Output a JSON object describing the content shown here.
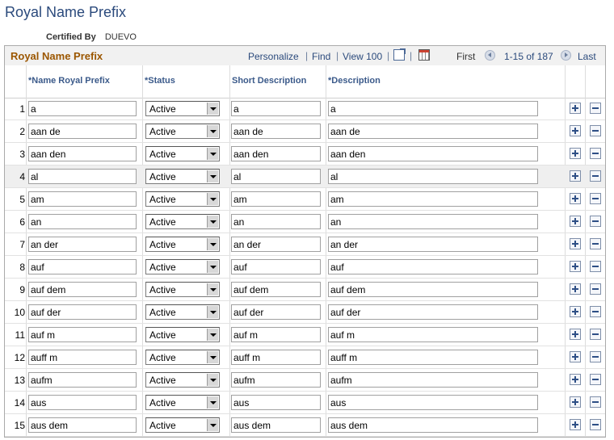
{
  "page": {
    "title": "Royal Name Prefix"
  },
  "certified": {
    "label": "Certified By",
    "value": "DUEVO"
  },
  "grid": {
    "title": "Royal Name Prefix",
    "personalize": "Personalize",
    "find": "Find",
    "view_all": "View 100",
    "first": "First",
    "range": "1-15 of 187",
    "last": "Last",
    "icons": {
      "popout": "new-window-icon",
      "download": "download-spreadsheet-icon",
      "prev": "previous-icon",
      "next": "next-icon",
      "add": "add-row-icon",
      "delete": "delete-row-icon"
    }
  },
  "columns": {
    "prefix": "*Name Royal Prefix",
    "status": "*Status",
    "short": "Short Description",
    "desc": "*Description"
  },
  "rows": [
    {
      "num": "1",
      "prefix": "a",
      "status": "Active",
      "short": "a",
      "desc": "a"
    },
    {
      "num": "2",
      "prefix": "aan de",
      "status": "Active",
      "short": "aan de",
      "desc": "aan de"
    },
    {
      "num": "3",
      "prefix": "aan den",
      "status": "Active",
      "short": "aan den",
      "desc": "aan den"
    },
    {
      "num": "4",
      "prefix": "al",
      "status": "Active",
      "short": "al",
      "desc": "al"
    },
    {
      "num": "5",
      "prefix": "am",
      "status": "Active",
      "short": "am",
      "desc": "am"
    },
    {
      "num": "6",
      "prefix": "an",
      "status": "Active",
      "short": "an",
      "desc": "an"
    },
    {
      "num": "7",
      "prefix": "an der",
      "status": "Active",
      "short": "an der",
      "desc": "an der"
    },
    {
      "num": "8",
      "prefix": "auf",
      "status": "Active",
      "short": "auf",
      "desc": "auf"
    },
    {
      "num": "9",
      "prefix": "auf dem",
      "status": "Active",
      "short": "auf dem",
      "desc": "auf dem"
    },
    {
      "num": "10",
      "prefix": "auf der",
      "status": "Active",
      "short": "auf der",
      "desc": "auf der"
    },
    {
      "num": "11",
      "prefix": "auf m",
      "status": "Active",
      "short": "auf m",
      "desc": "auf m"
    },
    {
      "num": "12",
      "prefix": "auff m",
      "status": "Active",
      "short": "auff m",
      "desc": "auff m"
    },
    {
      "num": "13",
      "prefix": "aufm",
      "status": "Active",
      "short": "aufm",
      "desc": "aufm"
    },
    {
      "num": "14",
      "prefix": "aus",
      "status": "Active",
      "short": "aus",
      "desc": "aus"
    },
    {
      "num": "15",
      "prefix": "aus dem",
      "status": "Active",
      "short": "aus dem",
      "desc": "aus dem"
    }
  ],
  "highlight_row": "4",
  "colors": {
    "title": "#2b4a7c",
    "grid_title": "#9b5600",
    "header_text": "#3b5a8a"
  }
}
